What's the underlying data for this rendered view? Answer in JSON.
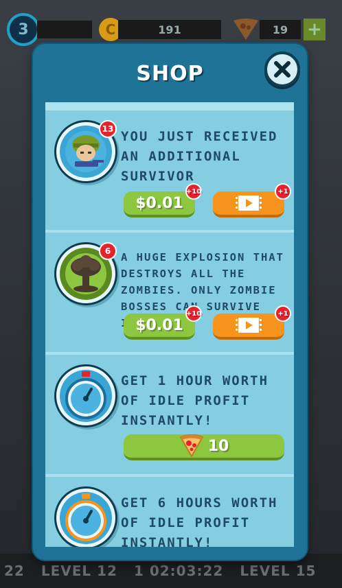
{
  "hud": {
    "level": "3",
    "coin_symbol": "C",
    "coins": "191",
    "slices": "19",
    "plus": "+"
  },
  "bottom": {
    "items": [
      "22",
      "LEVEL 12",
      "1 02:03:22",
      "LEVEL 15"
    ]
  },
  "shop": {
    "title": "SHOP",
    "items": [
      {
        "icon": "soldier-icon",
        "badge": "13",
        "description": "YOU JUST RECEIVED AN ADDITIONAL SURVIVOR",
        "price": "$0.01",
        "price_badge": "+10",
        "video_badge": "+1"
      },
      {
        "icon": "explosion-icon",
        "badge": "6",
        "description": "A HUGE EXPLOSION THAT DESTROYS ALL THE ZOMBIES. ONLY ZOMBIE BOSSES CAN SURVIVE IT.",
        "price": "$0.01",
        "price_badge": "+10",
        "video_badge": "+1"
      },
      {
        "icon": "stopwatch-icon",
        "description": "GET 1 HOUR WORTH OF IDLE PROFIT INSTANTLY!",
        "cost": "10"
      },
      {
        "icon": "stopwatch-icon",
        "description": "GET 6 HOURS WORTH OF IDLE PROFIT INSTANTLY!"
      }
    ]
  },
  "colors": {
    "modal": "#1f7396",
    "item_bg": "#85cee2",
    "text": "#1d4a66",
    "green_button": "#8dc63f",
    "orange_button": "#f7941d",
    "badge_red": "#e4232d"
  }
}
